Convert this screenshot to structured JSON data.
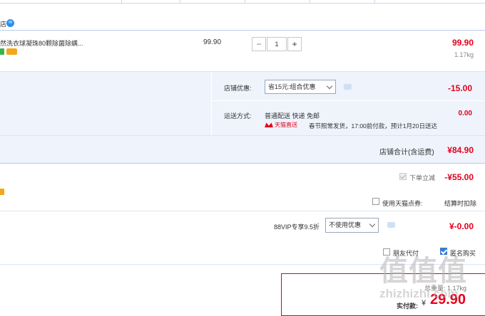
{
  "shop_label": "店",
  "product": {
    "title": "然洗衣球凝珠80颗除菌除螨...",
    "unit_price": "99.90",
    "quantity": "1",
    "minus": "−",
    "plus": "+",
    "subtotal": "99.90",
    "weight": "1.17kg"
  },
  "shop_discount": {
    "label": "店铺优惠:",
    "selected": "省15元:组合优惠",
    "amount": "-15.00"
  },
  "shipping": {
    "label": "运送方式:",
    "method": "普通配送 快递 免邮",
    "tmall_badge": "天猫直送",
    "note": "春节照常发货，17:00前付款，预计1月20日送达",
    "amount": "0.00"
  },
  "shop_total": {
    "label": "店铺合计(含运费)",
    "amount": "¥84.90"
  },
  "order_discount": {
    "label": "下单立减",
    "amount": "-¥55.00"
  },
  "tmall_points": {
    "label": "使用天猫点券:",
    "note": "结算时扣除"
  },
  "vip": {
    "label": "88VIP专享9.5折",
    "selected": "不使用优惠",
    "amount": "¥-0.00"
  },
  "options": {
    "friend_pay": "朋友代付",
    "anonymous": "匿名购买"
  },
  "summary": {
    "total_weight": "总重量: 1.17kg",
    "pay_label": "实付款:",
    "currency": "¥",
    "pay_amount": "29.90"
  },
  "watermark": {
    "logo": "值值值",
    "site": "zhizhizhi.com"
  },
  "colors": {
    "price_red": "#e4001b",
    "panel_blue": "#eef3fc",
    "border_blue": "#b9cbe9"
  }
}
